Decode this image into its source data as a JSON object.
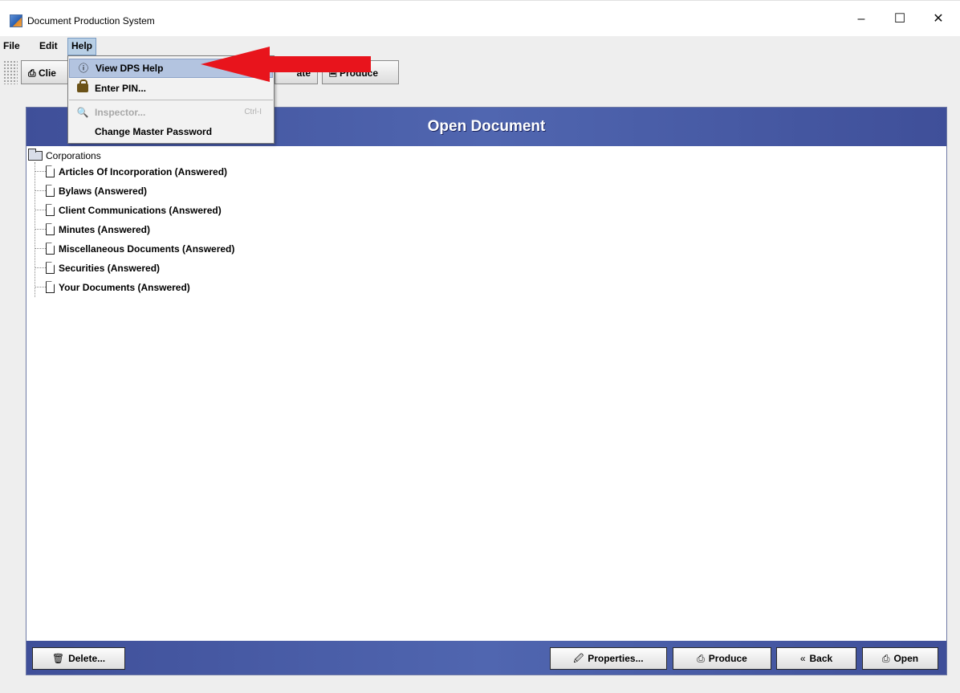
{
  "window": {
    "title": "Document Production System",
    "controls": [
      "–",
      "☐",
      "✕"
    ]
  },
  "menubar": {
    "items": [
      "File",
      "Edit",
      "Help"
    ],
    "active": "Help"
  },
  "toolbar": {
    "buttons": [
      {
        "label": "Clie",
        "icon": "printer-icon"
      },
      {
        "label": "ate",
        "icon": ""
      },
      {
        "label": "Produce",
        "icon": "document-icon"
      }
    ]
  },
  "help_menu": {
    "items": [
      {
        "label": "View DPS Help",
        "icon": "help-icon",
        "highlighted": true,
        "enabled": true
      },
      {
        "label": "Enter PIN...",
        "icon": "lock-icon",
        "enabled": true
      },
      {
        "label": "Inspector...",
        "icon": "magnifier-icon",
        "shortcut": "Ctrl-I",
        "enabled": false
      },
      {
        "label": "Change Master Password",
        "icon": "",
        "enabled": true
      }
    ]
  },
  "panel": {
    "header": "Open Document",
    "tree": {
      "root": "Corporations",
      "children": [
        "Articles Of Incorporation (Answered)",
        "Bylaws (Answered)",
        "Client Communications (Answered)",
        "Minutes (Answered)",
        "Miscellaneous Documents (Answered)",
        "Securities (Answered)",
        "Your Documents (Answered)"
      ]
    },
    "buttons": {
      "delete": "Delete...",
      "properties": "Properties...",
      "produce": "Produce",
      "back": "Back",
      "open": "Open"
    }
  },
  "annotation": {
    "arrow_color": "#e8141c"
  },
  "colors": {
    "header_blue": "#4a5aa6",
    "menu_highlight": "#b3c4e0"
  }
}
